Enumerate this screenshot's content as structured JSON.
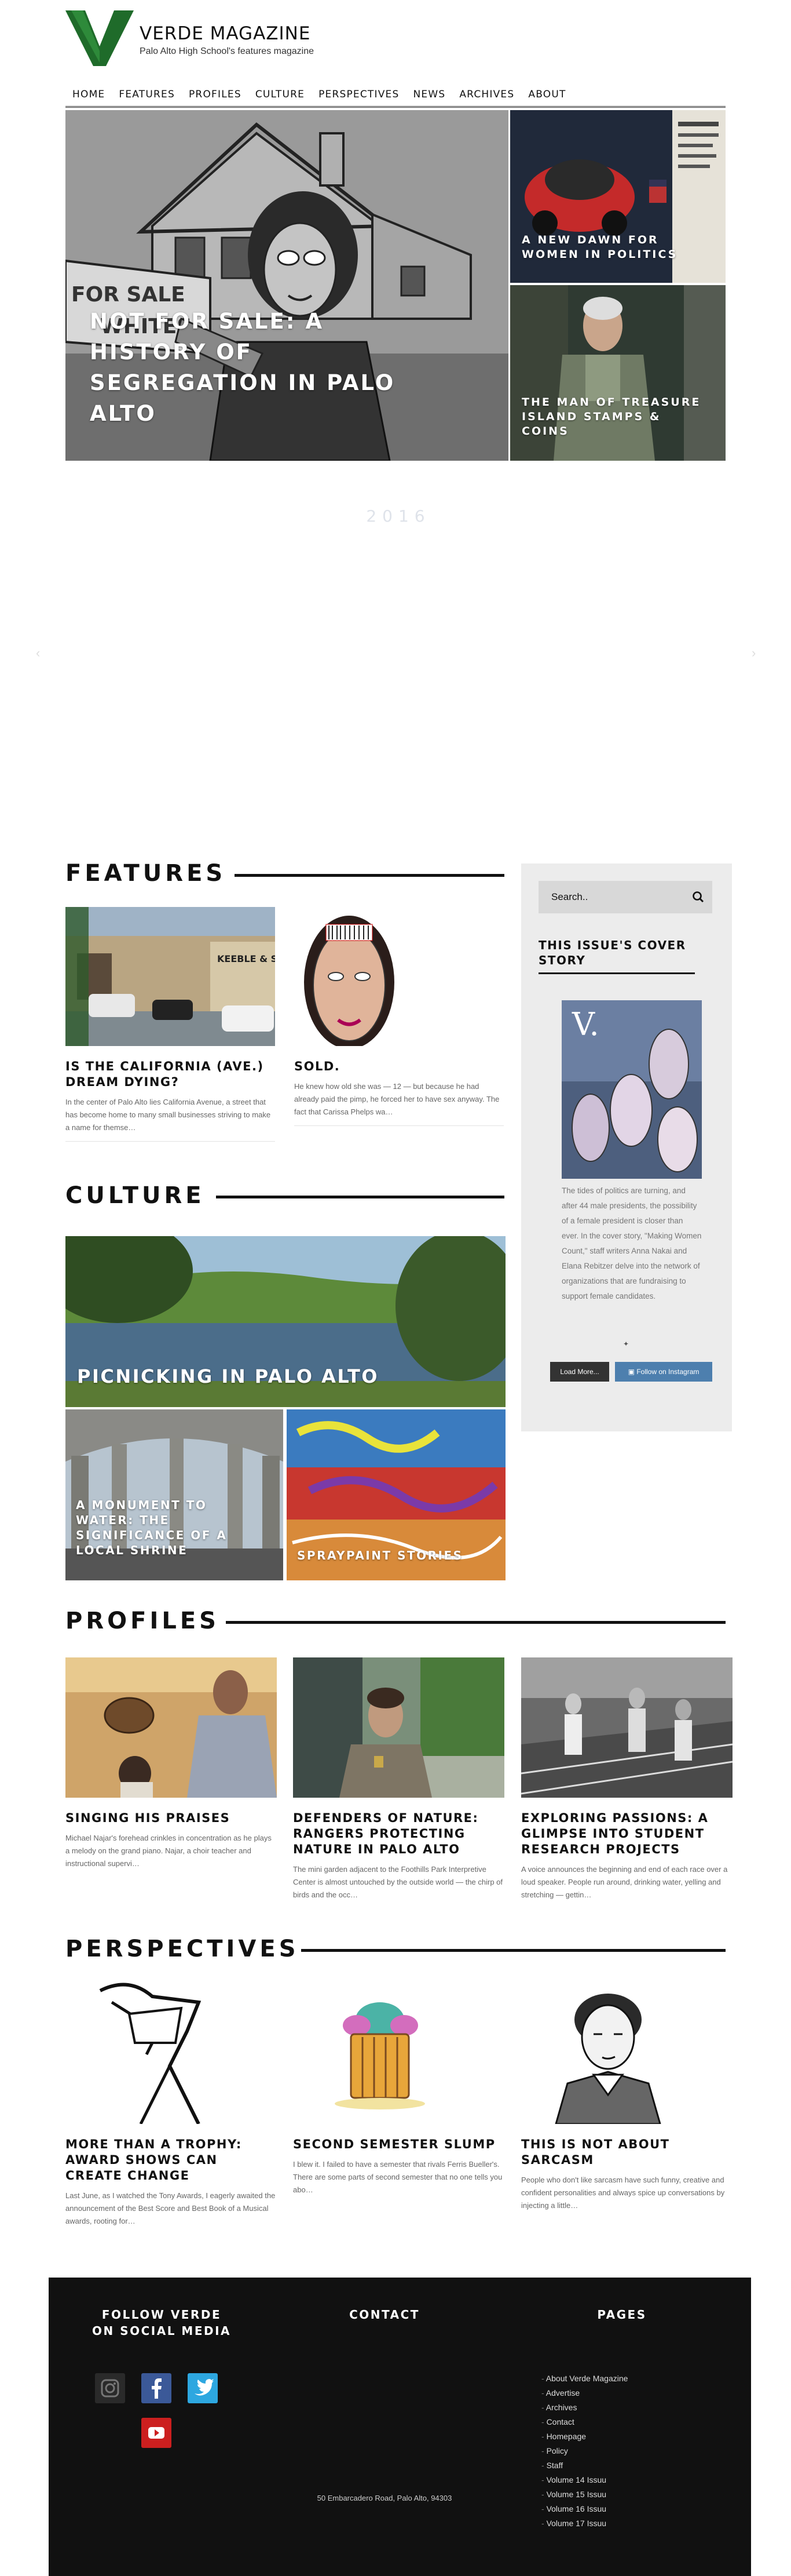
{
  "brand": {
    "title": "VERDE MAGAZINE",
    "subtitle": "Palo Alto High School's features magazine"
  },
  "nav": [
    "HOME",
    "FEATURES",
    "PROFILES",
    "CULTURE",
    "PERSPECTIVES",
    "NEWS",
    "ARCHIVES",
    "ABOUT"
  ],
  "hero": {
    "main_title": "NOT FOR SALE: A HISTORY OF SEGREGATION IN PALO ALTO",
    "side1_title": "A NEW DAWN FOR WOMEN IN POLITICS",
    "side2_title": "THE MAN OF TREASURE ISLAND STAMPS & COINS",
    "main_sign_text": "FOR SALE",
    "main_sign_text2": "WHITES"
  },
  "carousel": {
    "logo_text": "2016"
  },
  "features": {
    "heading": "FEATURES",
    "cards": [
      {
        "title": "IS THE CALIFORNIA (AVE.) DREAM DYING?",
        "excerpt": "In the center of Palo Alto lies California Avenue, a street that has become home to many small businesses striving to make a name for themse…",
        "store_sign": "KEEBLE & S"
      },
      {
        "title": "SOLD.",
        "excerpt": "He knew how old she was — 12 — but because he had already paid the pimp, he forced her to have sex anyway. The fact that Carissa Phelps wa…"
      }
    ]
  },
  "sidebar": {
    "search_placeholder": "Search..",
    "cover_heading": "THIS ISSUE'S COVER STORY",
    "cover_text": "The tides of politics are turning, and after 44 male presidents, the possibility of a female president is closer than ever. In the cover story, \"Making Women Count,\" staff writers Anna Nakai and Elana Rebitzer delve into the network of organizations that are fundraising to support female candidates.",
    "cover_letter": "V.",
    "load_more": "Load More...",
    "follow_instagram": "Follow on Instagram"
  },
  "culture": {
    "heading": "CULTURE",
    "big_title": "PICNICKING IN PALO ALTO",
    "small1_title": "A MONUMENT TO WATER: THE SIGNIFICANCE OF A LOCAL SHRINE",
    "small2_title": "SPRAYPAINT STORIES"
  },
  "profiles": {
    "heading": "PROFILES",
    "cards": [
      {
        "title": "SINGING HIS PRAISES",
        "excerpt": "Michael Najar's forehead crinkles in concentration as he plays a melody on the grand piano. Najar, a choir teacher and instructional supervi…"
      },
      {
        "title": "DEFENDERS OF NATURE: RANGERS PROTECTING NATURE IN PALO ALTO",
        "excerpt": "The mini garden adjacent to the Foothills Park Interpretive Center is almost untouched by the outside world — the chirp of birds and the occ…"
      },
      {
        "title": "EXPLORING PASSIONS: A GLIMPSE INTO STUDENT RESEARCH PROJECTS",
        "excerpt": "A voice announces the beginning and end of each race over a loud speaker. People run around, drinking water, yelling and stretching — gettin…"
      }
    ]
  },
  "perspectives": {
    "heading": "PERSPECTIVES",
    "cards": [
      {
        "title": "MORE THAN A TROPHY: AWARD SHOWS CAN CREATE CHANGE",
        "excerpt": "Last June, as I watched the Tony Awards, I eagerly awaited the announcement of the Best Score and Best Book of a Musical awards, rooting for…"
      },
      {
        "title": "SECOND SEMESTER SLUMP",
        "excerpt": "I blew it. I failed to have a semester that rivals Ferris Bueller's. There are some parts of second semester that no one tells you abo…"
      },
      {
        "title": "THIS IS NOT ABOUT SARCASM",
        "excerpt": "People who don't like sarcasm have such funny, creative and confident personalities and always spice up conversations by injecting a little…"
      }
    ]
  },
  "footer": {
    "social_heading": "FOLLOW VERDE ON SOCIAL MEDIA",
    "contact_heading": "CONTACT",
    "pages_heading": "PAGES",
    "address": "50 Embarcadero Road, Palo Alto, 94303",
    "pages": [
      "About Verde Magazine",
      "Advertise",
      "Archives",
      "Contact",
      "Homepage",
      "Policy",
      "Staff",
      "Volume 14 Issuu",
      "Volume 15 Issuu",
      "Volume 16 Issuu",
      "Volume 17 Issuu"
    ]
  },
  "colors": {
    "brand_green": "#1f6b2a",
    "facebook": "#3b5998",
    "twitter": "#2da7e0",
    "youtube": "#cc1f1f",
    "footer_bg": "#111111"
  }
}
